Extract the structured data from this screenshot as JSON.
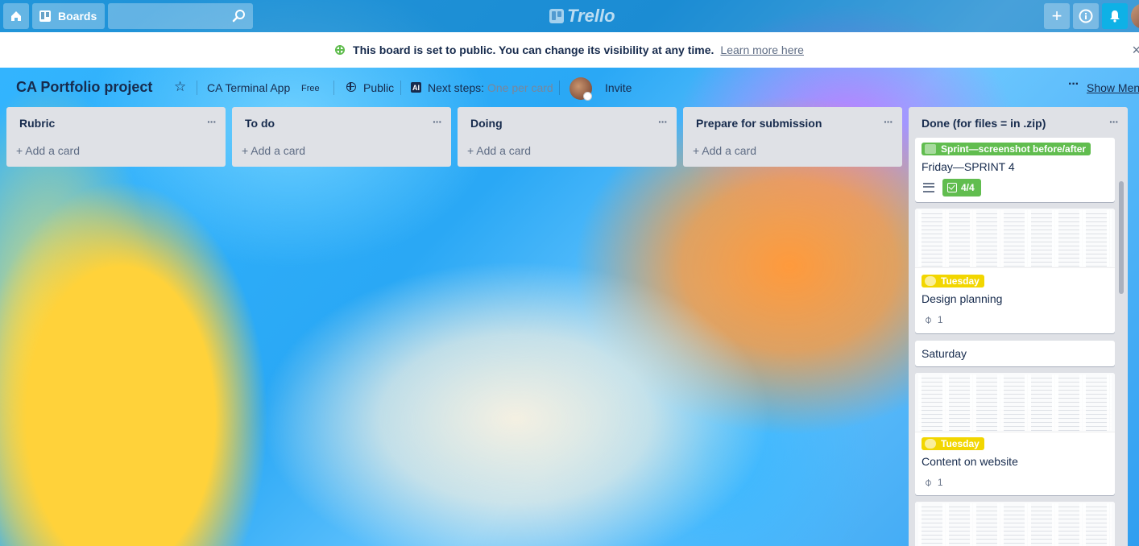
{
  "topbar": {
    "boards_label": "Boards",
    "logo_text": "Trello",
    "icons": [
      "home-icon",
      "boards-icon",
      "search-icon",
      "add-icon",
      "info-icon",
      "bell-icon"
    ]
  },
  "banner": {
    "text": "This board is set to public. You can change its visibility at any time.",
    "link": "Learn more here"
  },
  "board": {
    "title": "CA Portfolio project",
    "team": "CA Terminal App",
    "plan": "Free",
    "visibility": "Public",
    "next_steps_label": "Next steps:",
    "next_steps_value": "One per card",
    "invite": "Invite",
    "more_glyph": "···",
    "show_menu": "Show Menu"
  },
  "lists": [
    {
      "title": "Rubric",
      "menu": "···",
      "add": "+ Add a card"
    },
    {
      "title": "To do",
      "menu": "···",
      "add": "+ Add a card"
    },
    {
      "title": "Doing",
      "menu": "···",
      "add": "+ Add a card"
    },
    {
      "title": "Prepare for submission",
      "menu": "···",
      "add": "+ Add a card"
    }
  ],
  "done_list": {
    "title": "Done (for files = in .zip)",
    "menu": "···",
    "cards": [
      {
        "label": "Sprint—screenshot before/after",
        "label_color": "#61bd4f",
        "title": "Friday—SPRINT 4",
        "checklist": "4/4"
      },
      {
        "label": "Tuesday",
        "label_color": "#f2d600",
        "title": "Design planning",
        "attachments": "1"
      },
      {
        "title": "Saturday"
      },
      {
        "label": "Tuesday",
        "label_color": "#f2d600",
        "title": "Content on website",
        "attachments": "1"
      }
    ]
  },
  "colors": {
    "list_bg": "#dfe1e6",
    "label_green": "#61bd4f",
    "label_yellow": "#f2d600",
    "notification": "#0eb1e6"
  }
}
